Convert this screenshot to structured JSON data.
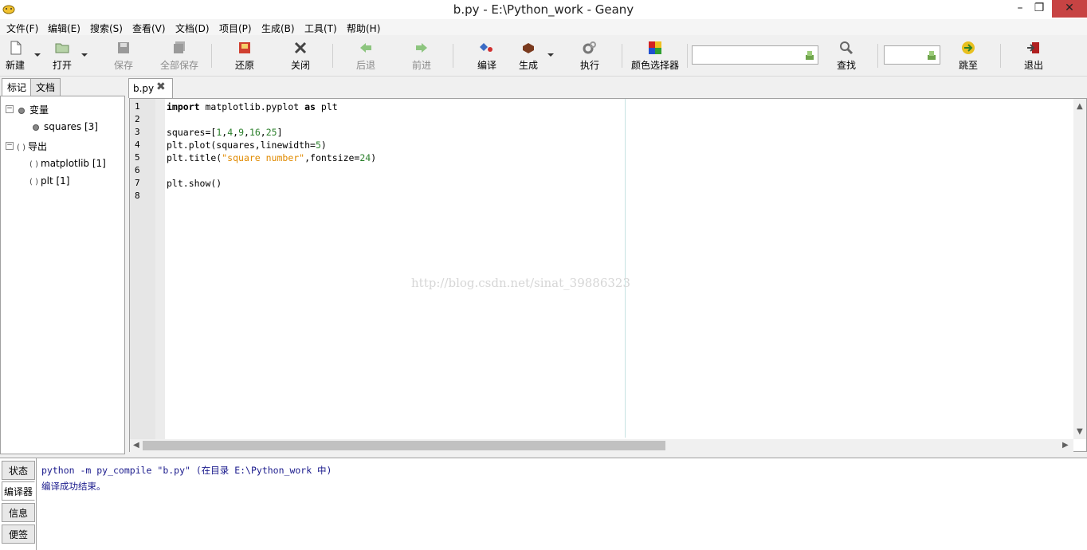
{
  "window": {
    "title": "b.py - E:\\Python_work - Geany",
    "minimize_glyph": "–",
    "maximize_glyph": "❐",
    "close_glyph": "✕"
  },
  "menu": [
    "文件(F)",
    "编辑(E)",
    "搜索(S)",
    "查看(V)",
    "文档(D)",
    "项目(P)",
    "生成(B)",
    "工具(T)",
    "帮助(H)"
  ],
  "toolbar": {
    "new": "新建",
    "open": "打开",
    "save": "保存",
    "save_all": "全部保存",
    "revert": "还原",
    "close": "关闭",
    "back": "后退",
    "forward": "前进",
    "compile": "编译",
    "build": "生成",
    "execute": "执行",
    "color_chooser": "颜色选择器",
    "search_value": "",
    "find": "查找",
    "goto_value": "",
    "goto": "跳至",
    "quit": "退出"
  },
  "sidebar": {
    "tabs": [
      "标记",
      "文档"
    ],
    "tree": {
      "variables_label": "变量",
      "variables": [
        "squares [3]"
      ],
      "imports_label": "导出",
      "imports": [
        "matplotlib [1]",
        "plt [1]"
      ]
    }
  },
  "editor": {
    "tab_label": "b.py",
    "tab_close_glyph": "✖",
    "line_numbers": [
      "1",
      "2",
      "3",
      "4",
      "5",
      "6",
      "7",
      "8"
    ],
    "lines": [
      [
        {
          "t": "import",
          "c": "kw"
        },
        {
          "t": " matplotlib.pyplot ",
          "c": ""
        },
        {
          "t": "as",
          "c": "kw"
        },
        {
          "t": " plt",
          "c": ""
        }
      ],
      [],
      [
        {
          "t": "squares=[",
          "c": ""
        },
        {
          "t": "1",
          "c": "num"
        },
        {
          "t": ",",
          "c": ""
        },
        {
          "t": "4",
          "c": "num"
        },
        {
          "t": ",",
          "c": ""
        },
        {
          "t": "9",
          "c": "num"
        },
        {
          "t": ",",
          "c": ""
        },
        {
          "t": "16",
          "c": "num"
        },
        {
          "t": ",",
          "c": ""
        },
        {
          "t": "25",
          "c": "num"
        },
        {
          "t": "]",
          "c": ""
        }
      ],
      [
        {
          "t": "plt.plot(squares,linewidth=",
          "c": ""
        },
        {
          "t": "5",
          "c": "num"
        },
        {
          "t": ")",
          "c": ""
        }
      ],
      [
        {
          "t": "plt.title(",
          "c": ""
        },
        {
          "t": "\"square number\"",
          "c": "str"
        },
        {
          "t": ",fontsize=",
          "c": ""
        },
        {
          "t": "24",
          "c": "num"
        },
        {
          "t": ")",
          "c": ""
        }
      ],
      [],
      [
        {
          "t": "plt.show()",
          "c": ""
        }
      ],
      []
    ],
    "watermark": "http://blog.csdn.net/sinat_39886323"
  },
  "messages": {
    "tabs": [
      "状态",
      "编译器",
      "信息",
      "便签"
    ],
    "active_tab": 1,
    "lines": [
      "python -m py_compile \"b.py\" (在目录 E:\\Python_work 中)",
      "编译成功结束。"
    ]
  },
  "colors": {
    "number": "#2a7f2a",
    "string": "#e08a00",
    "close_button": "#c74343",
    "long_line_marker": "#c8e3e3"
  }
}
